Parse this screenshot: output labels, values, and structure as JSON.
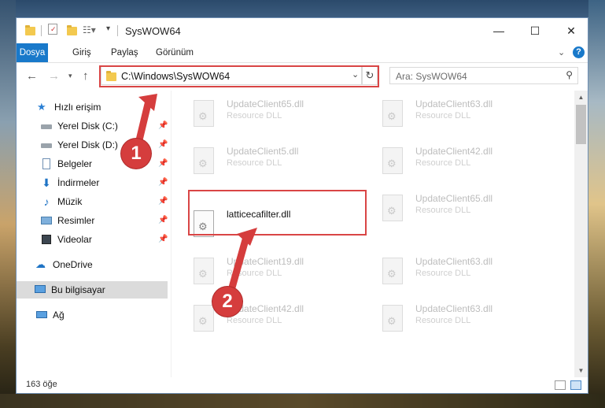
{
  "window": {
    "title": "SysWOW64"
  },
  "ribbon": {
    "tabs": [
      "Dosya",
      "Giriş",
      "Paylaş",
      "Görünüm"
    ]
  },
  "nav": {
    "address": "C:\\Windows\\SysWOW64",
    "search_placeholder": "Ara: SysWOW64"
  },
  "sidebar": {
    "quick_access": "Hızlı erişim",
    "items": [
      {
        "label": "Yerel Disk (C:)",
        "icon": "drive-icon",
        "pinned": true
      },
      {
        "label": "Yerel Disk (D:)",
        "icon": "drive-icon",
        "pinned": true
      },
      {
        "label": "Belgeler",
        "icon": "documents-icon",
        "pinned": true
      },
      {
        "label": "İndirmeler",
        "icon": "downloads-icon",
        "pinned": true
      },
      {
        "label": "Müzik",
        "icon": "music-icon",
        "pinned": true
      },
      {
        "label": "Resimler",
        "icon": "pictures-icon",
        "pinned": true
      },
      {
        "label": "Videolar",
        "icon": "videos-icon",
        "pinned": true
      }
    ],
    "onedrive": "OneDrive",
    "this_pc": "Bu bilgisayar",
    "network": "Ağ"
  },
  "files": [
    {
      "name": "UpdateClient65.dll",
      "type": "Resource DLL"
    },
    {
      "name": "UpdateClient63.dll",
      "type": "Resource DLL"
    },
    {
      "name": "UpdateClient5.dll",
      "type": "Resource DLL"
    },
    {
      "name": "UpdateClient42.dll",
      "type": "Resource DLL"
    },
    {
      "name": "latticecafilter.dll",
      "type": ""
    },
    {
      "name": "UpdateClient65.dll",
      "type": "Resource DLL"
    },
    {
      "name": "UpdateClient19.dll",
      "type": "Resource DLL"
    },
    {
      "name": "UpdateClient63.dll",
      "type": "Resource DLL"
    },
    {
      "name": "UpdateClient42.dll",
      "type": "Resource DLL"
    },
    {
      "name": "UpdateClient63.dll",
      "type": "Resource DLL"
    }
  ],
  "status": {
    "count": "163 öğe"
  },
  "callouts": [
    "1",
    "2"
  ],
  "colors": {
    "accent": "#1979ca",
    "highlight": "#d94545",
    "callout": "#d53d3d"
  }
}
